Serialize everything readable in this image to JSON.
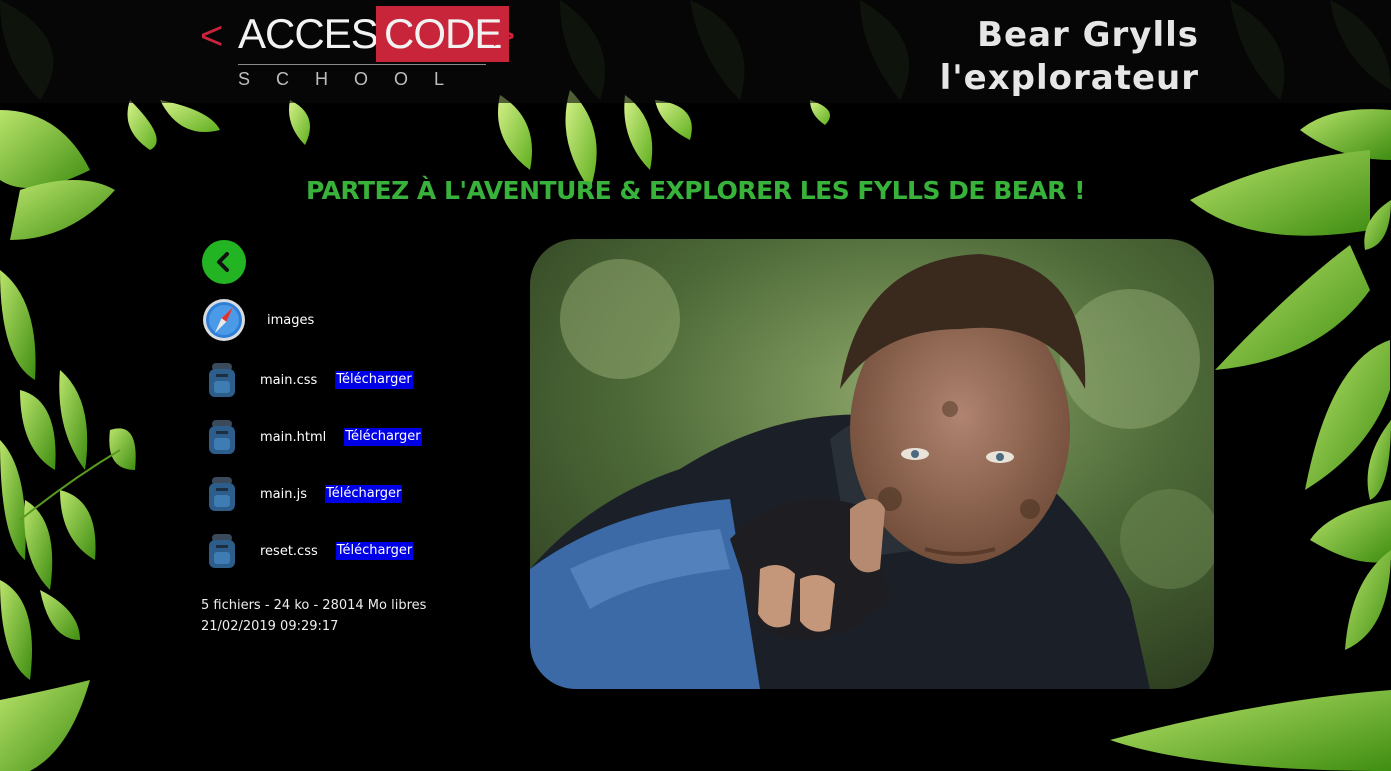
{
  "header": {
    "logo": {
      "lt": "<",
      "access": "ACCESS",
      "code": "CODE",
      "gt": ">",
      "school": "SCHOOL"
    },
    "title_line1": "Bear Grylls",
    "title_line2": "l'explorateur"
  },
  "headline": "PARTEZ À L'AVENTURE & EXPLORER LES FYLLS DE BEAR !",
  "files": [
    {
      "name": "images",
      "icon": "safari-compass-icon",
      "download": ""
    },
    {
      "name": "main.css",
      "icon": "backpack-icon",
      "download": "Télécharger"
    },
    {
      "name": "main.html",
      "icon": "backpack-icon",
      "download": "Télécharger"
    },
    {
      "name": "main.js",
      "icon": "backpack-icon",
      "download": "Télécharger"
    },
    {
      "name": "reset.css",
      "icon": "backpack-icon",
      "download": "Télécharger"
    }
  ],
  "status": {
    "summary": "5 fichiers - 24 ko - 28014 Mo libres",
    "datetime": "21/02/2019 09:29:17"
  },
  "colors": {
    "accent_green": "#38b23a",
    "logo_red": "#c8243a",
    "download_bg": "#0000e6"
  }
}
